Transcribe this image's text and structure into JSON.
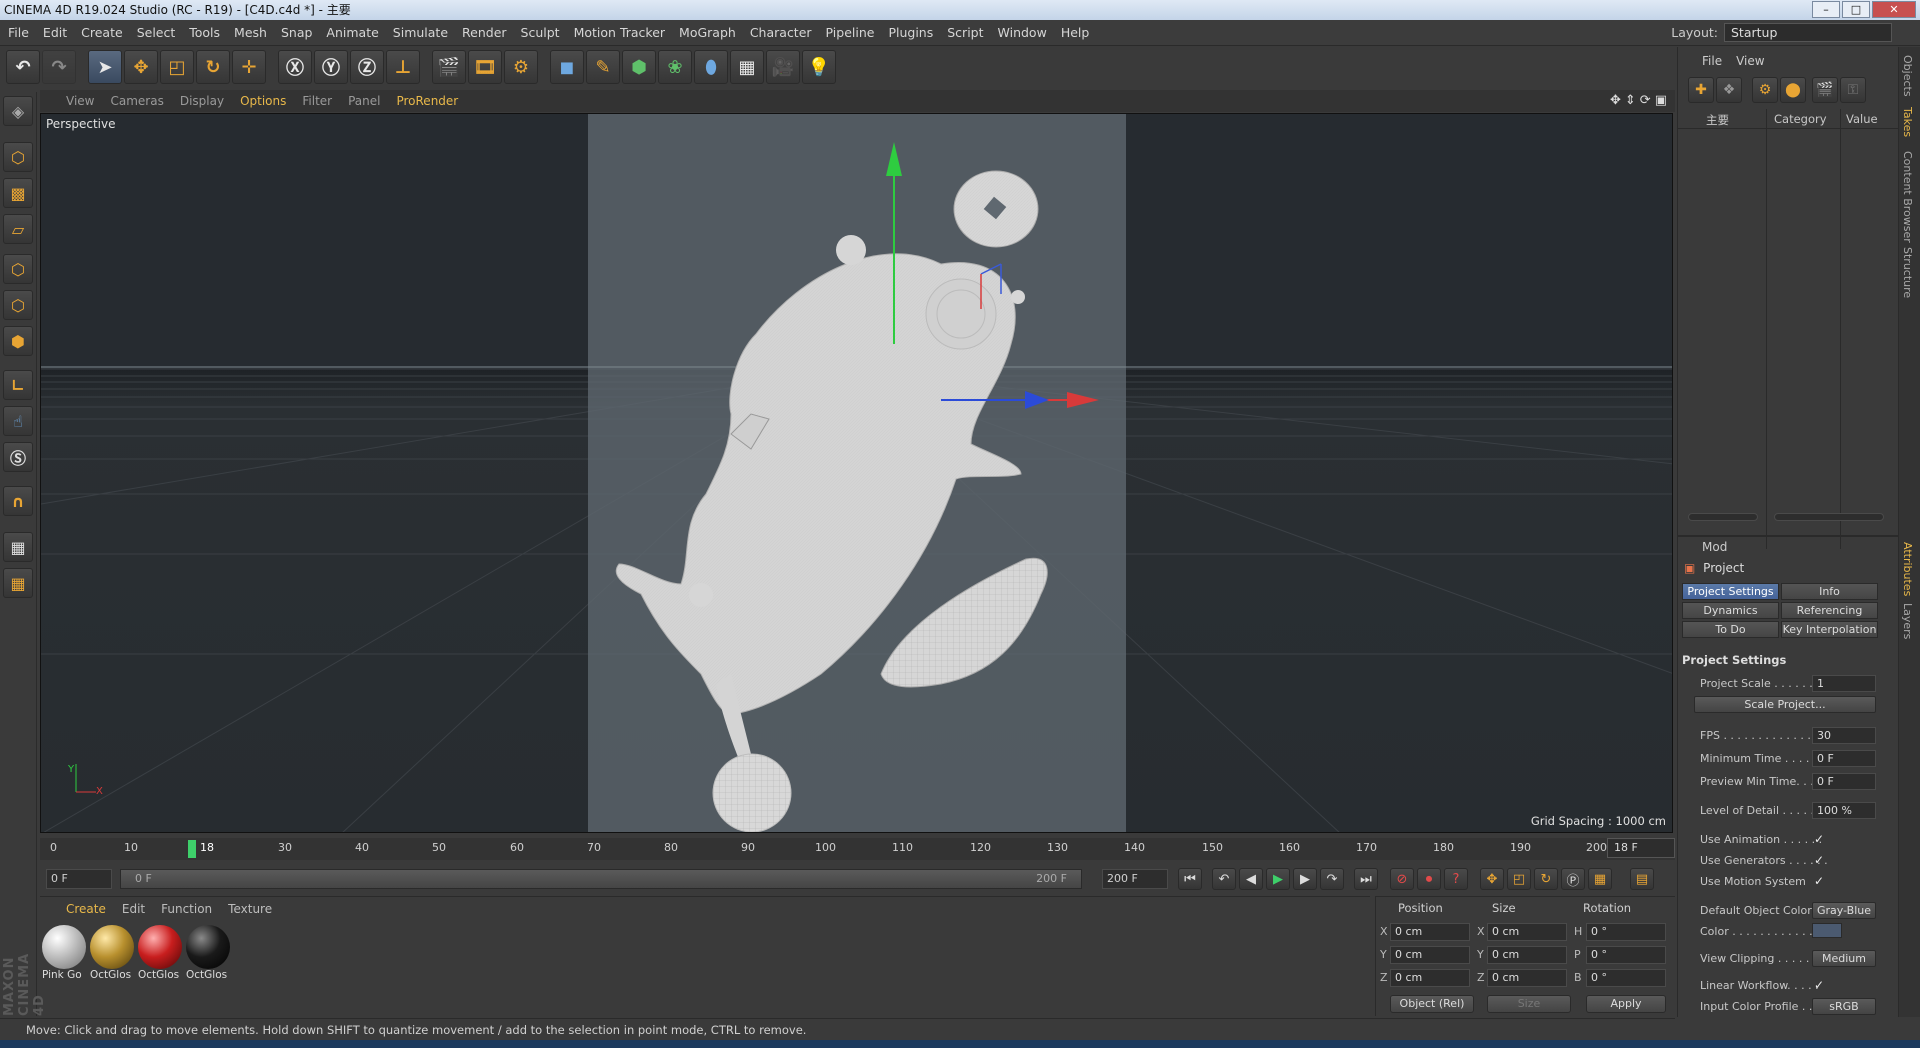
{
  "window": {
    "title": "CINEMA 4D R19.024 Studio (RC - R19) - [C4D.c4d *] - 主要",
    "controls": [
      "–",
      "□",
      "✕"
    ]
  },
  "menu": {
    "items": [
      "File",
      "Edit",
      "Create",
      "Select",
      "Tools",
      "Mesh",
      "Snap",
      "Animate",
      "Simulate",
      "Render",
      "Sculpt",
      "Motion Tracker",
      "MoGraph",
      "Character",
      "Pipeline",
      "Plugins",
      "Script",
      "Window",
      "Help"
    ],
    "layout_label": "Layout:",
    "layout_value": "Startup"
  },
  "viewport": {
    "menu": [
      "View",
      "Cameras",
      "Display",
      "Options",
      "Filter",
      "Panel",
      "ProRender"
    ],
    "highlighted": [
      "Options",
      "ProRender"
    ],
    "label": "Perspective",
    "grid_spacing": "Grid Spacing : 1000 cm",
    "axis_y": "Y",
    "axis_x": "X"
  },
  "timeline": {
    "ticks": [
      "0",
      "10",
      "18",
      "30",
      "40",
      "50",
      "60",
      "70",
      "80",
      "90",
      "100",
      "110",
      "120",
      "130",
      "140",
      "150",
      "160",
      "170",
      "180",
      "190",
      "200"
    ],
    "current_frame": "18 F",
    "start_field": "0 F",
    "slider_start": "0 F",
    "slider_end": "200 F",
    "end_field": "200 F"
  },
  "material_manager": {
    "menu": [
      "Create",
      "Edit",
      "Function",
      "Texture"
    ],
    "materials": [
      {
        "name": "Pink Go",
        "color": "#c8c8c8"
      },
      {
        "name": "OctGlos",
        "color": "#b8902e"
      },
      {
        "name": "OctGlos",
        "color": "#c81e1e"
      },
      {
        "name": "OctGlos",
        "color": "#1a1a1a"
      }
    ]
  },
  "coordinates": {
    "headers": [
      "Position",
      "Size",
      "Rotation"
    ],
    "rows": [
      {
        "pos_axis": "X",
        "pos": "0 cm",
        "size_axis": "X",
        "size": "0 cm",
        "rot_axis": "H",
        "rot": "0 °"
      },
      {
        "pos_axis": "Y",
        "pos": "0 cm",
        "size_axis": "Y",
        "size": "0 cm",
        "rot_axis": "P",
        "rot": "0 °"
      },
      {
        "pos_axis": "Z",
        "pos": "0 cm",
        "size_axis": "Z",
        "size": "0 cm",
        "rot_axis": "B",
        "rot": "0 °"
      }
    ],
    "mode": "Object (Rel)",
    "size_mode": "Size",
    "apply": "Apply"
  },
  "status": "Move: Click and drag to move elements. Hold down SHIFT to quantize movement / add to the selection in point mode, CTRL to remove.",
  "objects_panel": {
    "menu": [
      "File",
      "View"
    ],
    "item": "主要",
    "col_category": "Category",
    "col_value": "Value"
  },
  "attributes": {
    "menu": "Mod",
    "title": "Project",
    "tabs": [
      "Project Settings",
      "Info",
      "Dynamics",
      "Referencing",
      "To Do",
      "Key Interpolation"
    ],
    "section": "Project Settings",
    "scale_label": "Project Scale . . . . . . . .",
    "scale_value": "1",
    "scale_button": "Scale Project...",
    "fps_label": "FPS . . . . . . . . . . . . . . .",
    "fps_value": "30",
    "min_time_label": "Minimum Time . . . . . . .",
    "min_time_value": "0 F",
    "preview_min_label": "Preview Min Time. . . .",
    "preview_min_value": "0 F",
    "lod_label": "Level of Detail . . . . . .",
    "lod_value": "100 %",
    "use_anim_label": "Use Animation . . . . . .",
    "use_gen_label": "Use Generators . . . . . .",
    "use_motion_label": "Use Motion System",
    "default_color_label": "Default Object Color",
    "default_color_value": "Gray-Blue",
    "color_label": "Color . . . . . . . . . . . .",
    "view_clip_label": "View Clipping . . . . . . .",
    "view_clip_value": "Medium",
    "linear_label": "Linear Workflow. . . . .",
    "input_profile_label": "Input Color Profile . . .",
    "input_profile_value": "sRGB",
    "check": "✓"
  },
  "side_tabs": [
    "Objects",
    "Takes",
    "Content Browser",
    "Structure",
    "Attributes",
    "Layers"
  ],
  "brand": "MAXON CINEMA 4D"
}
